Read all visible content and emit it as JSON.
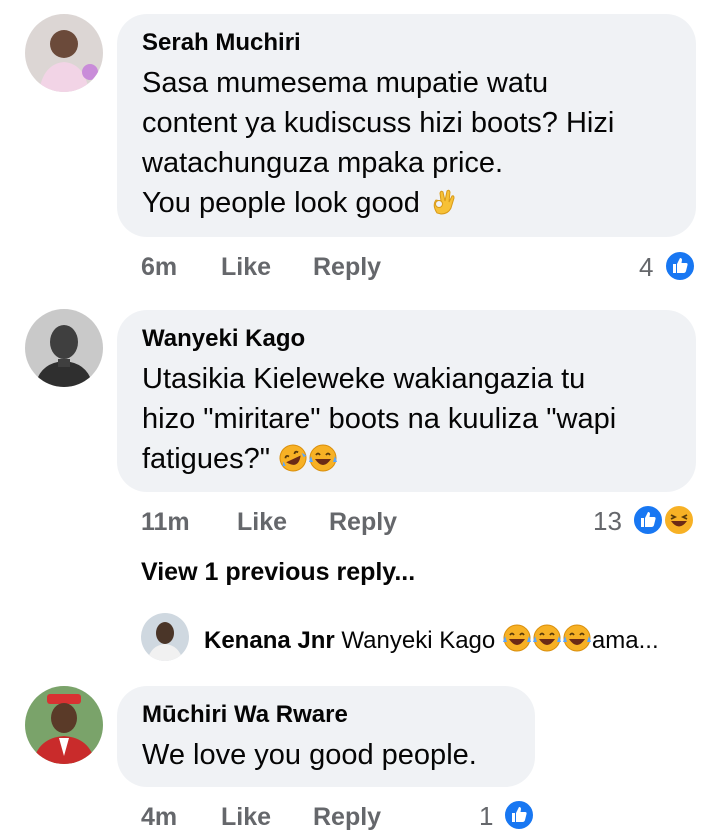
{
  "comments": [
    {
      "author": "Serah Muchiri",
      "text": "Sasa mumesema mupatie watu\ncontent ya kudiscuss hizi boots? Hizi\nwatachunguza mpaka price.\nYou people look good",
      "text_emoji": "ok-hand",
      "time": "6m",
      "like_label": "Like",
      "reply_label": "Reply",
      "reaction_count": "4",
      "reactions": [
        "like"
      ]
    },
    {
      "author": "Wanyeki Kago",
      "text": "Utasikia Kieleweke wakiangazia tu\nhizo \"miritare\" boots na kuuliza \"wapi\nfatigues?\"",
      "text_emoji": "rofl, joy",
      "time": "11m",
      "like_label": "Like",
      "reply_label": "Reply",
      "reaction_count": "13",
      "reactions": [
        "like",
        "haha"
      ],
      "view_replies": "View 1 previous reply...",
      "reply_preview": {
        "author": "Kenana Jnr",
        "text_prefix": "Wanyeki Kago ",
        "text_suffix": "ama..."
      }
    },
    {
      "author": "Mūchiri Wa Rware",
      "text": "We love you good people.",
      "time": "4m",
      "like_label": "Like",
      "reply_label": "Reply",
      "reaction_count": "1",
      "reactions": [
        "like"
      ]
    }
  ],
  "colors": {
    "bubble": "#f0f2f5",
    "meta_text": "#65676b",
    "like_blue": "#1877f2",
    "haha_yellow": "#f7b125"
  }
}
